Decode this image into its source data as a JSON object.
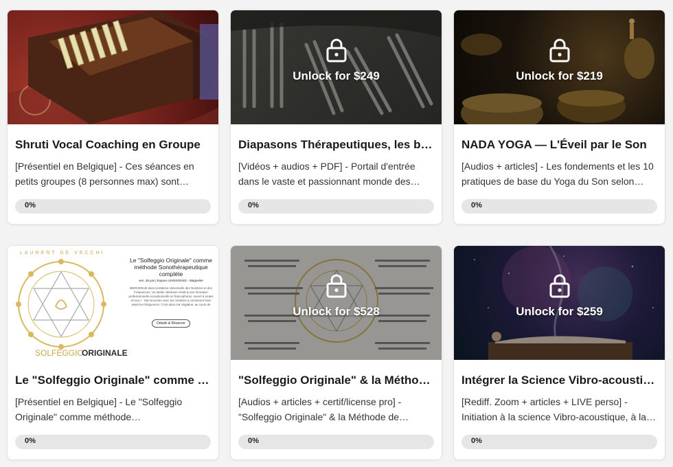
{
  "courses": [
    {
      "title": "Shruti Vocal Coaching en Groupe",
      "description": "[Présentiel en Belgique] - Ces séances en petits groupes (8 personnes max) sont…",
      "progress_label": "0%",
      "progress": 0,
      "locked": false,
      "unlock_label": "",
      "image": "harmonium"
    },
    {
      "title": "Diapasons Thérapeutiques, les bases",
      "description": "[Vidéos + audios + PDF] - Portail d'entrée dans le vaste et passionnant monde des…",
      "progress_label": "0%",
      "progress": 0,
      "locked": true,
      "unlock_label": "Unlock for $249",
      "image": "tuning-forks"
    },
    {
      "title": "NADA YOGA — L'Éveil par le Son",
      "description": "[Audios + articles] - Les fondements et les 10 pratiques de base du Yoga du Son selon…",
      "progress_label": "0%",
      "progress": 0,
      "locked": true,
      "unlock_label": "Unlock for $219",
      "image": "singing-bowls"
    },
    {
      "title": "Le \"Solfeggio Originale\" comme méthode",
      "description": "[Présentiel en Belgique] - Le \"Solfeggio Originale\" comme méthode…",
      "progress_label": "0%",
      "progress": 0,
      "locked": false,
      "unlock_label": "",
      "image": "solfeggio-flyer",
      "flyer": {
        "author": "LAURENT DE VECCHI",
        "heading": "Le \"Solfeggio Originale\" comme méthode Sonothérapeutique complète",
        "date_line": "ven. 26 juin | Espace UNISSONSD - Wagnelée",
        "body": "BIENVENUE dans la Matrice Universelle des Nombres et des Fréquences. Un atelier vibratoire inédit & une formation professionnelle exceptionnelle en francophonie, ouvert à toutes et tous ! - Ma rencontre avec les nombres a commencé bien avant les fréquences. C'est dans ma vingtaine, au cours de",
        "button": "Détails & Réserver",
        "logo_top": "SOLFEGGIO",
        "logo_bottom": "ORIGINALE"
      }
    },
    {
      "title": "\"Solfeggio Originale\" & la Méthode de calcul",
      "description": "[Audios + articles + certif/license pro] - \"Solfeggio Originale\" & la Méthode de calcul…",
      "progress_label": "0%",
      "progress": 0,
      "locked": true,
      "unlock_label": "Unlock for $528",
      "image": "solfeggio-chart"
    },
    {
      "title": "Intégrer la Science Vibro-acoustique",
      "description": "[Rediff. Zoom + articles + LIVE perso] - Initiation à la science Vibro-acoustique, à la…",
      "progress_label": "0%",
      "progress": 0,
      "locked": true,
      "unlock_label": "Unlock for $259",
      "image": "cosmic-sound-bath"
    }
  ],
  "colors": {
    "page_bg": "#f3f3f3",
    "card_bg": "#ffffff",
    "progress_track": "#e6e6e6",
    "title_text": "#1a1a1a",
    "lock_overlay": "#ffffff"
  },
  "icons": {
    "locked": "padlock-icon"
  }
}
